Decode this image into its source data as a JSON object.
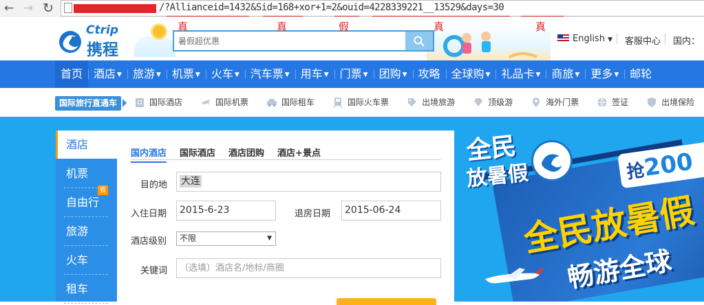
{
  "browser": {
    "url_prefix": "/?",
    "url_text": "Allianceid=1432&Sid=168+xor+1=2&ouid=4228339221__13529&days=30",
    "annotations": [
      "真",
      "真",
      "假",
      "真",
      "真"
    ]
  },
  "header": {
    "logo_latin": "Ctrip",
    "logo_cn": "携程",
    "search": {
      "placeholder": "暑假超优惠"
    },
    "language": "English",
    "service": "客服中心",
    "domestic": "国内："
  },
  "main_nav": {
    "items": [
      {
        "label": "首页",
        "dropdown": false
      },
      {
        "label": "酒店",
        "dropdown": true
      },
      {
        "label": "旅游",
        "dropdown": true
      },
      {
        "label": "机票",
        "dropdown": true
      },
      {
        "label": "火车",
        "dropdown": true
      },
      {
        "label": "汽车票",
        "dropdown": true
      },
      {
        "label": "用车",
        "dropdown": true
      },
      {
        "label": "门票",
        "dropdown": true
      },
      {
        "label": "团购",
        "dropdown": true
      },
      {
        "label": "攻略",
        "dropdown": false
      },
      {
        "label": "全球购",
        "dropdown": true
      },
      {
        "label": "礼品卡",
        "dropdown": true
      },
      {
        "label": "商旅",
        "dropdown": true
      },
      {
        "label": "更多",
        "dropdown": true
      },
      {
        "label": "邮轮",
        "dropdown": false
      }
    ]
  },
  "sub_nav": {
    "badge": "国际旅行直通车",
    "items": [
      {
        "label": "国际酒店",
        "icon": "building-icon"
      },
      {
        "label": "国际机票",
        "icon": "plane-icon"
      },
      {
        "label": "国际租车",
        "icon": "car-icon"
      },
      {
        "label": "国际火车票",
        "icon": "train-icon"
      },
      {
        "label": "出境旅游",
        "icon": "tag-icon"
      },
      {
        "label": "顶级游",
        "icon": "diamond-icon"
      },
      {
        "label": "海外门票",
        "icon": "location-pin-icon"
      },
      {
        "label": "签证",
        "icon": "globe-icon"
      },
      {
        "label": "出境保险",
        "icon": "shield-icon"
      }
    ]
  },
  "side_menu": {
    "items": [
      "酒店",
      "机票",
      "自由行",
      "旅游",
      "火车",
      "租车"
    ],
    "save_badge": "省"
  },
  "hotel_form": {
    "tabs": [
      "国内酒店",
      "国际酒店",
      "酒店团购",
      "酒店+景点"
    ],
    "destination_label": "目的地",
    "destination_value": "大连",
    "checkin_label": "入住日期",
    "checkin_value": "2015-6-23",
    "checkout_label": "退房日期",
    "checkout_value": "2015-06-24",
    "level_label": "酒店级别",
    "level_value": "不限",
    "keyword_label": "关键词",
    "keyword_placeholder": "（选填）酒店名/地标/商圈"
  },
  "promo": {
    "title_line1": "全民",
    "title_line2": "放暑假",
    "grab": "抢",
    "grab_amount": "200",
    "big_line1": "全民放暑假",
    "big_line2": "畅游全球"
  },
  "colors": {
    "nav_blue": "#2577e3",
    "hero_blue": "#1fa6ef",
    "accent_orange": "#ff9a00",
    "annotation_red": "#e0272a"
  }
}
